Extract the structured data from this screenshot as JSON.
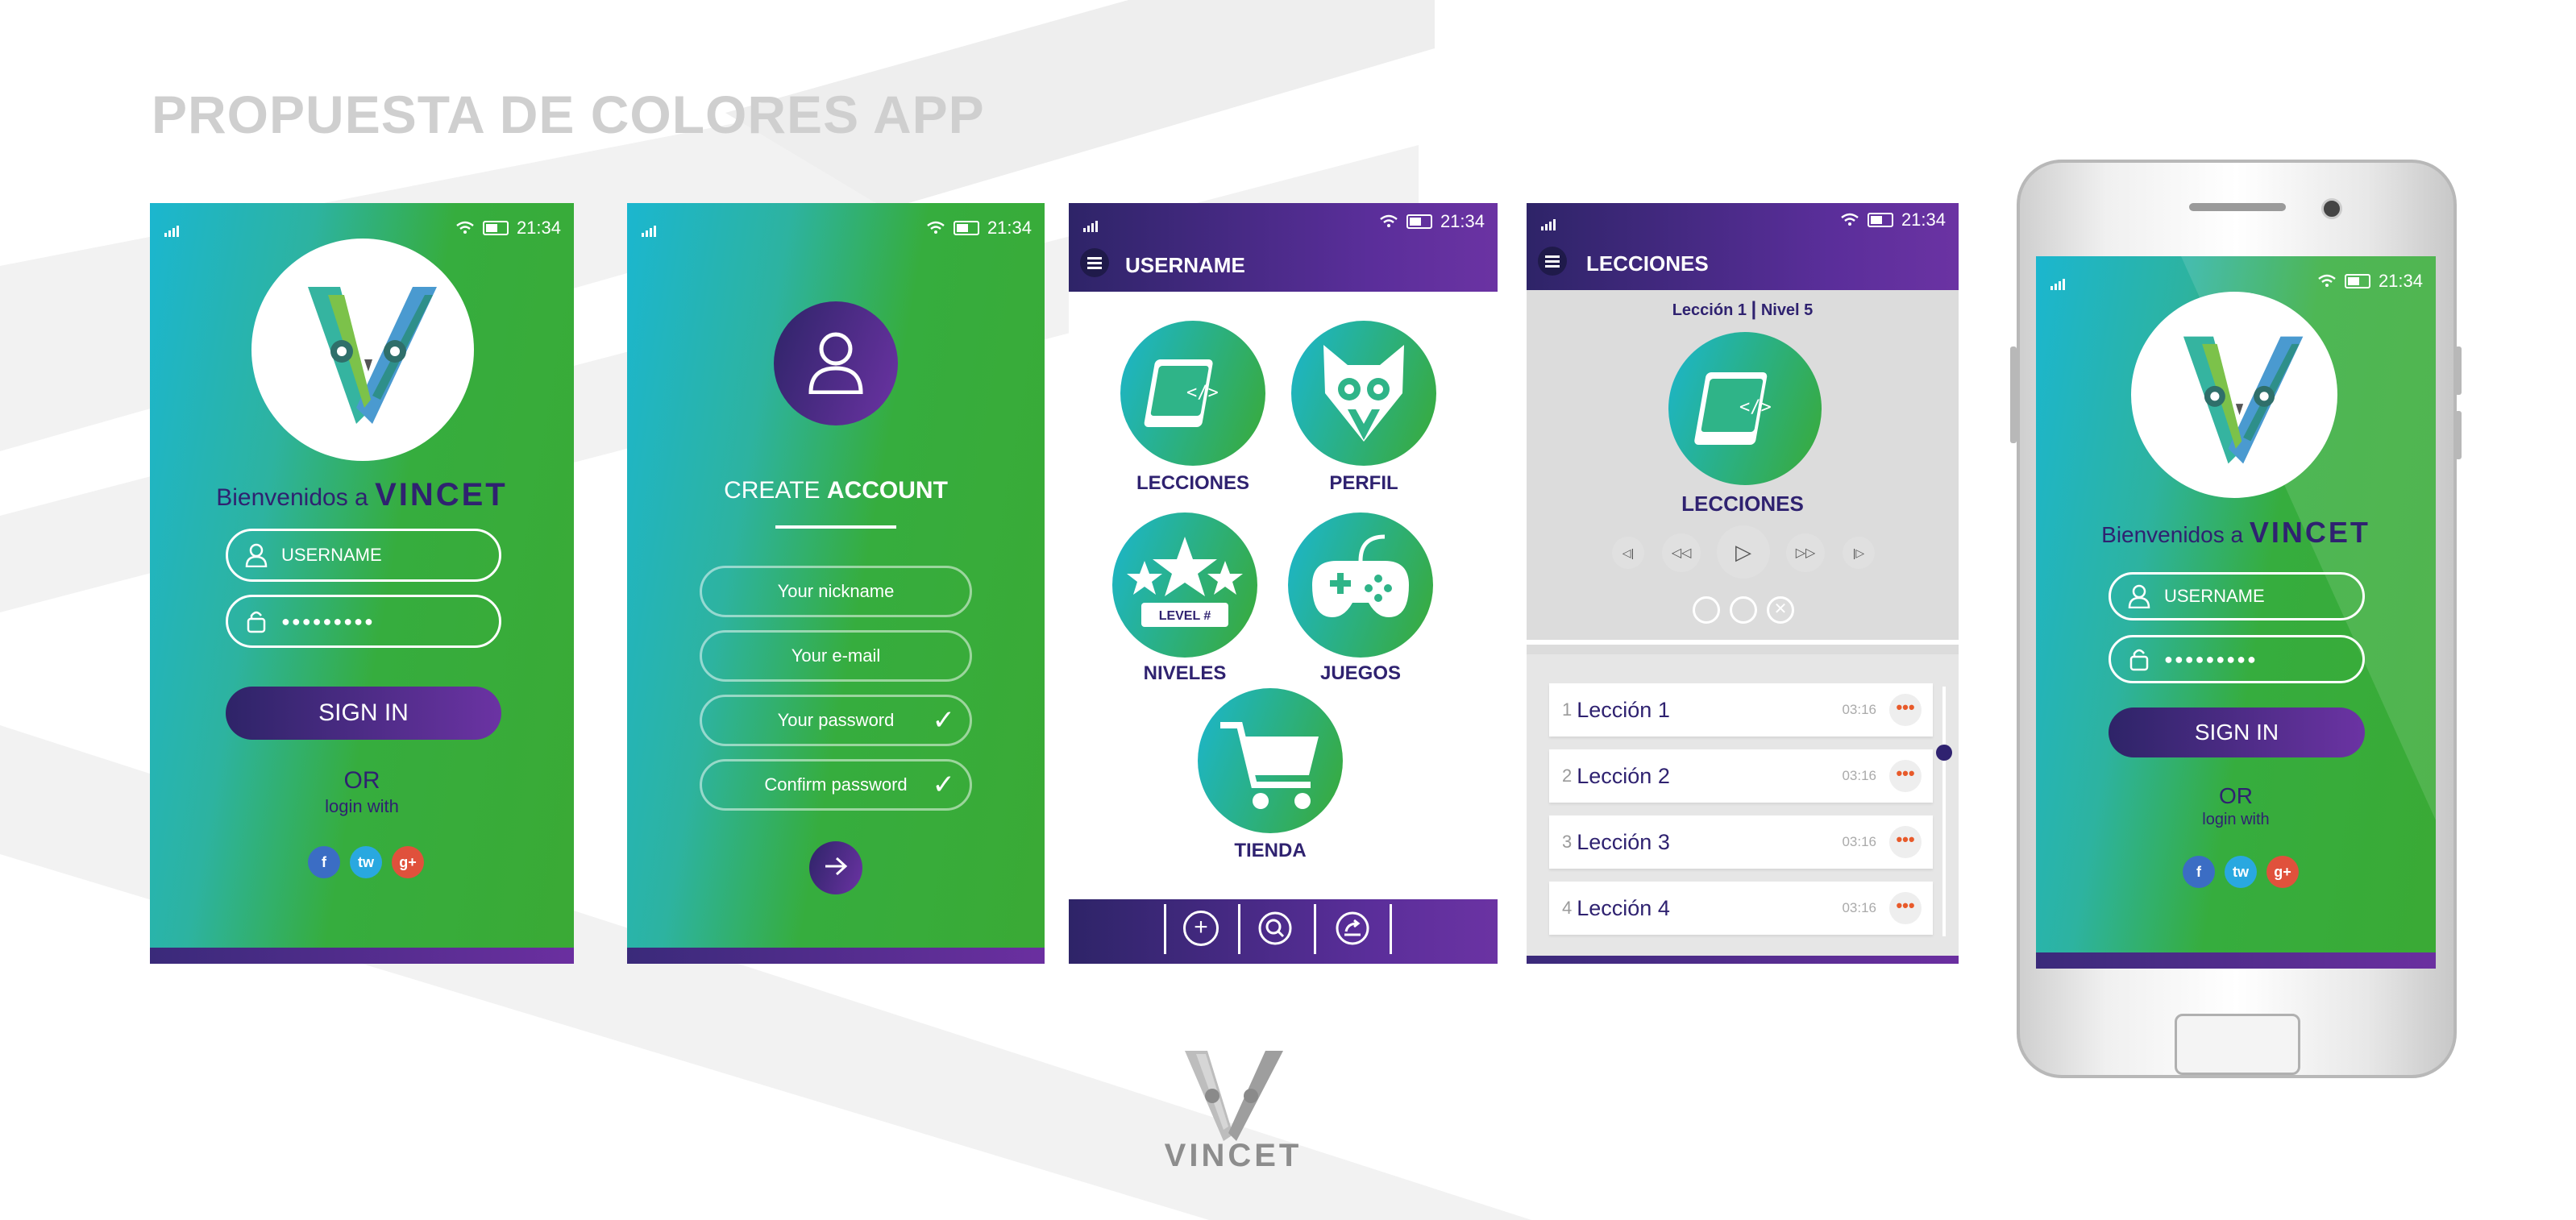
{
  "page_title": "PROPUESTA DE COLORES APP",
  "status": {
    "time": "21:34"
  },
  "login": {
    "welcome_prefix": "Bienvenidos a",
    "brand": "VINCET",
    "username_placeholder": "USERNAME",
    "password_mask": "●●●●●●●●●",
    "signin_label": "SIGN IN",
    "or_label": "OR",
    "login_with": "login with",
    "social": [
      "f",
      "tw",
      "g+"
    ]
  },
  "create": {
    "title_light": "CREATE",
    "title_bold": "ACCOUNT",
    "fields": [
      "Your nickname",
      "Your e-mail",
      "Your password",
      "Confirm password"
    ],
    "checkmark": "✓"
  },
  "menu": {
    "header": "USERNAME",
    "items": [
      "LECCIONES",
      "PERFIL",
      "NIVELES",
      "JUEGOS",
      "TIENDA"
    ],
    "level_badge": "LEVEL #"
  },
  "lessons": {
    "header": "LECCIONES",
    "subtitle_left": "Lección 1",
    "subtitle_sep": "|",
    "subtitle_right": "Nivel 5",
    "main_label": "LECCIONES",
    "list": [
      {
        "num": "1",
        "name": "Lección 1",
        "time": "03:16"
      },
      {
        "num": "2",
        "name": "Lección 2",
        "time": "03:16"
      },
      {
        "num": "3",
        "name": "Lección 3",
        "time": "03:16"
      },
      {
        "num": "4",
        "name": "Lección 4",
        "time": "03:16"
      }
    ],
    "dots": "•••"
  },
  "footer_brand": "VINCET",
  "colors": {
    "green": "#3aaa35",
    "cyan": "#1bb6cf",
    "purple": "#6b33a3",
    "navy": "#2f2270"
  }
}
